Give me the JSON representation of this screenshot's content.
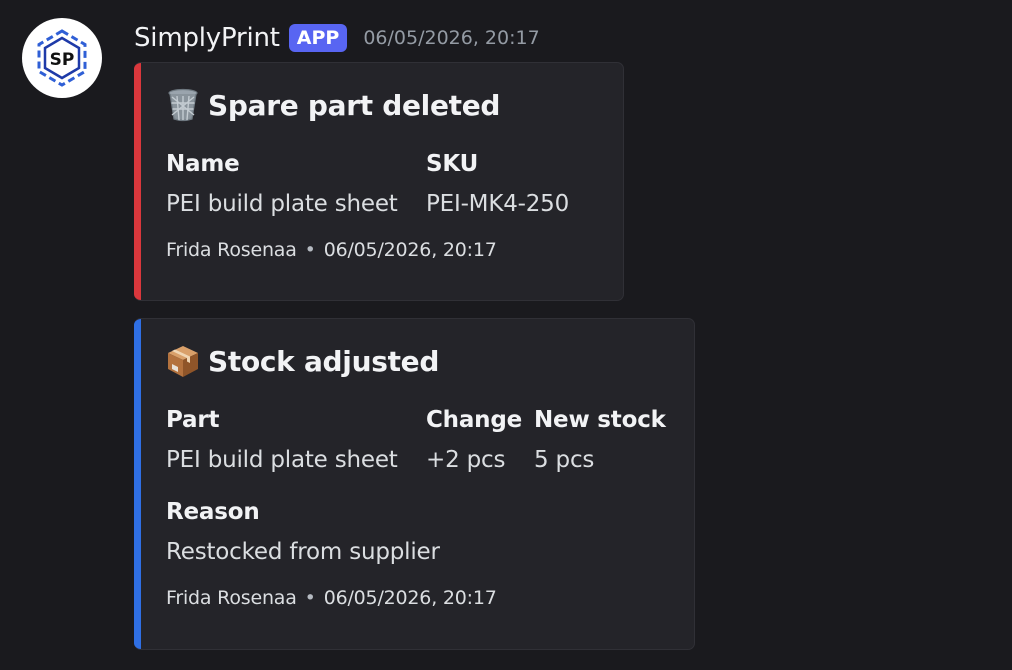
{
  "message": {
    "username": "SimplyPrint",
    "badge": "APP",
    "timestamp": "06/05/2026, 20:17",
    "avatar_initials": "SP"
  },
  "embeds": [
    {
      "color": "#da373c",
      "icon": "wastebasket-icon",
      "title": "Spare part deleted",
      "fields": [
        {
          "name": "Name",
          "value": "PEI build plate sheet"
        },
        {
          "name": "SKU",
          "value": "PEI-MK4-250"
        }
      ],
      "footer": {
        "author": "Frida Rosenaa",
        "separator": "•",
        "timestamp": "06/05/2026, 20:17"
      }
    },
    {
      "color": "#2f6fe4",
      "icon": "package-icon",
      "title": "Stock adjusted",
      "fields": [
        {
          "name": "Part",
          "value": "PEI build plate sheet"
        },
        {
          "name": "Change",
          "value": "+2 pcs"
        },
        {
          "name": "New stock",
          "value": "5 pcs"
        },
        {
          "name": "Reason",
          "value": "Restocked from supplier"
        }
      ],
      "footer": {
        "author": "Frida Rosenaa",
        "separator": "•",
        "timestamp": "06/05/2026, 20:17"
      }
    }
  ]
}
